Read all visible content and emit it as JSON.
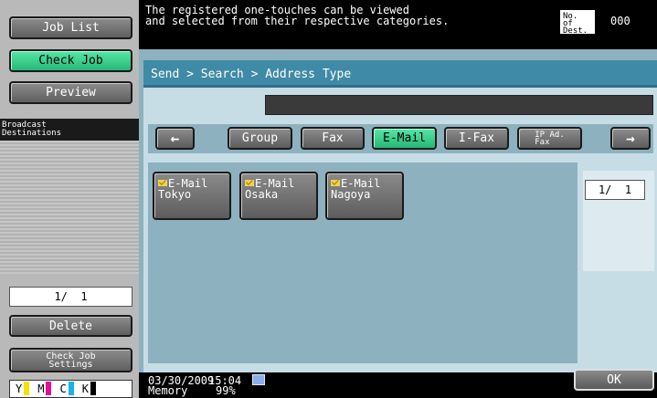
{
  "header": {
    "message": "The registered one-touches can be viewed\nand selected from their respective categories.",
    "dest_label": "No. of\nDest.",
    "dest_count": "000"
  },
  "left": {
    "job_list": "Job List",
    "check_job": "Check Job",
    "preview": "Preview",
    "broadcast_label": "Broadcast\nDestinations",
    "page": "1/  1",
    "delete": "Delete",
    "check_job_settings": "Check Job\nSettings",
    "toner": [
      {
        "letter": "Y",
        "color": "#f5e200"
      },
      {
        "letter": "M",
        "color": "#e0109a"
      },
      {
        "letter": "C",
        "color": "#18b4e8"
      },
      {
        "letter": "K",
        "color": "#000000"
      }
    ]
  },
  "main": {
    "breadcrumb": "Send > Search > Address Type",
    "tabs": {
      "prev": "←",
      "group": "Group",
      "fax": "Fax",
      "email": "E-Mail",
      "ifax": "I-Fax",
      "ipfax": "IP Ad.\nFax",
      "next": "→"
    },
    "active_tab": "E-Mail",
    "addresses": [
      {
        "type": "E-Mail",
        "name": "Tokyo"
      },
      {
        "type": "E-Mail",
        "name": "Osaka"
      },
      {
        "type": "E-Mail",
        "name": "Nagoya"
      }
    ],
    "page": "1/  1"
  },
  "footer": {
    "date": "03/30/2009",
    "memory_label": "Memory",
    "time": "15:04",
    "memory_value": "99%",
    "ok": "OK"
  },
  "colors": {
    "accent_green": "#3fd08f",
    "panel_blue": "#3f8aa6",
    "mail_icon": "#f2d24a"
  }
}
